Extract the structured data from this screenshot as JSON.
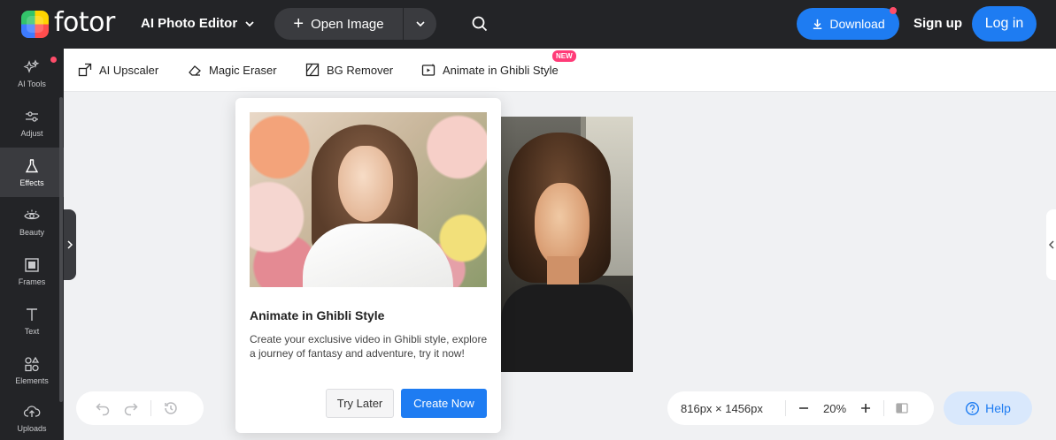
{
  "brand": {
    "name": "fotor"
  },
  "header": {
    "editor_menu": "AI Photo Editor",
    "open_image": "Open Image",
    "download": "Download",
    "signup": "Sign up",
    "login": "Log in"
  },
  "sidebar": {
    "items": [
      {
        "label": "AI Tools",
        "icon": "sparkle-icon"
      },
      {
        "label": "Adjust",
        "icon": "sliders-icon"
      },
      {
        "label": "Effects",
        "icon": "flask-icon",
        "active": true
      },
      {
        "label": "Beauty",
        "icon": "eye-icon"
      },
      {
        "label": "Frames",
        "icon": "frame-icon"
      },
      {
        "label": "Text",
        "icon": "text-icon"
      },
      {
        "label": "Elements",
        "icon": "shapes-icon"
      },
      {
        "label": "Uploads",
        "icon": "upload-icon"
      }
    ]
  },
  "toolbar": {
    "items": [
      {
        "label": "AI Upscaler",
        "icon": "upscale-icon"
      },
      {
        "label": "Magic Eraser",
        "icon": "eraser-icon"
      },
      {
        "label": "BG Remover",
        "icon": "bg-remove-icon"
      },
      {
        "label": "Animate in Ghibli Style",
        "icon": "animate-icon"
      }
    ],
    "new_badge": "NEW"
  },
  "popup": {
    "title": "Animate in Ghibli Style",
    "description": "Create your exclusive video in Ghibli style, explore a journey of fantasy and adventure, try it now!",
    "try_later": "Try Later",
    "create_now": "Create Now"
  },
  "canvas": {
    "image_size": "816px × 1456px",
    "zoom": "20%"
  },
  "help": {
    "label": "Help"
  },
  "colors": {
    "accent": "#1e7cf2",
    "dark": "#232427",
    "badge": "#ff3b78"
  }
}
